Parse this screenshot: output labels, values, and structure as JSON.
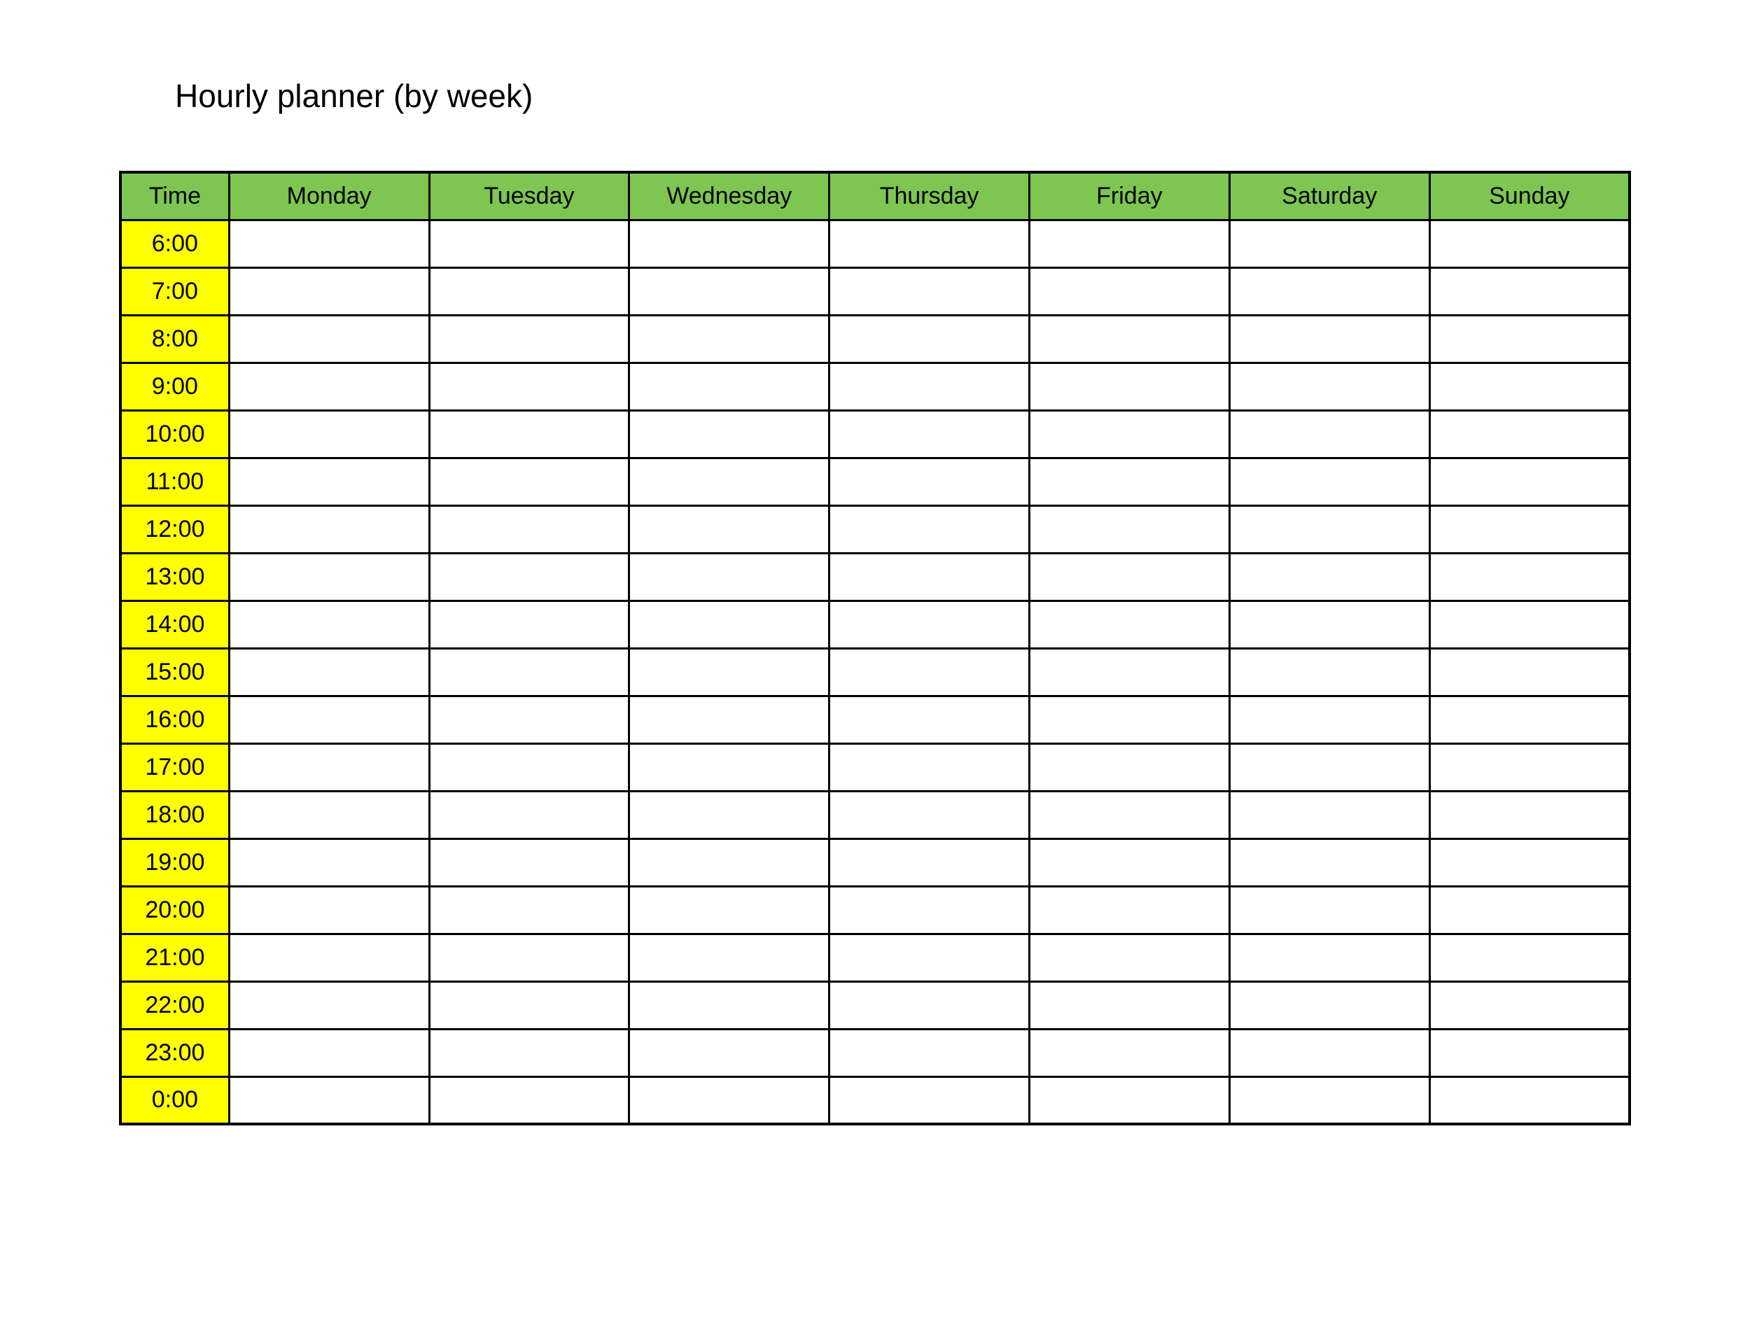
{
  "title": "Hourly planner (by week)",
  "headers": {
    "time": "Time",
    "days": [
      "Monday",
      "Tuesday",
      "Wednesday",
      "Thursday",
      "Friday",
      "Saturday",
      "Sunday"
    ]
  },
  "times": [
    "6:00",
    "7:00",
    "8:00",
    "9:00",
    "10:00",
    "11:00",
    "12:00",
    "13:00",
    "14:00",
    "15:00",
    "16:00",
    "17:00",
    "18:00",
    "19:00",
    "20:00",
    "21:00",
    "22:00",
    "23:00",
    "0:00"
  ],
  "cells": {}
}
